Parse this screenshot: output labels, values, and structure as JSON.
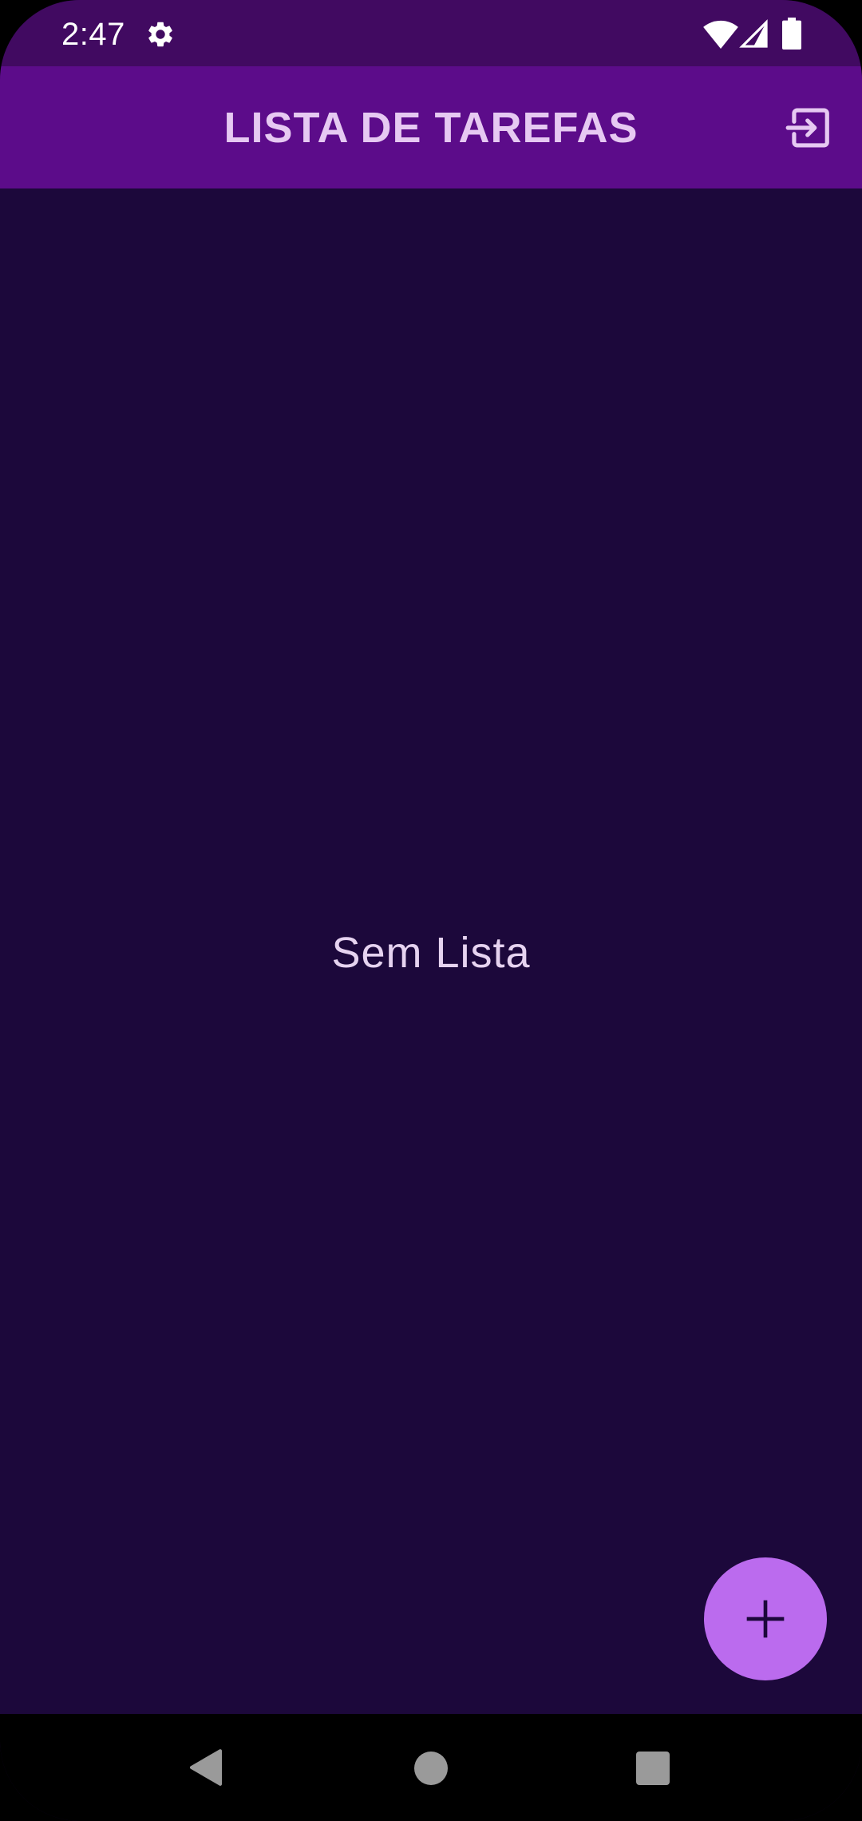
{
  "status_bar": {
    "time": "2:47",
    "icons": [
      "gear-icon",
      "wifi-icon",
      "signal-icon",
      "battery-icon"
    ]
  },
  "app_bar": {
    "title": "LISTA DE TAREFAS",
    "action_icon": "logout-icon"
  },
  "main": {
    "empty_message": "Sem Lista"
  },
  "fab": {
    "icon": "plus-icon"
  },
  "nav_bar": {
    "buttons": [
      "back-icon",
      "home-icon",
      "recents-icon"
    ]
  },
  "colors": {
    "status_bar": "#410a61",
    "app_bar": "#5c0c8a",
    "background": "#1c083b",
    "title_text": "#e6c9f2",
    "fab": "#bb6bee",
    "nav_bar": "#000000"
  }
}
